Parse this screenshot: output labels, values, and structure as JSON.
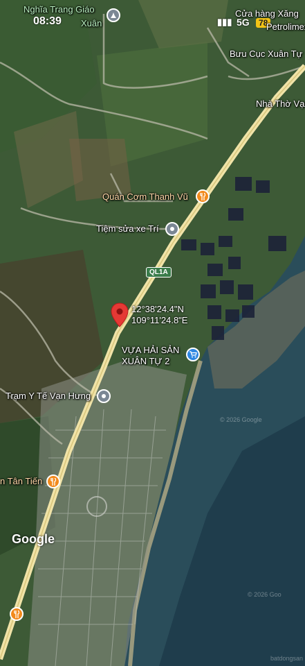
{
  "status_bar": {
    "time": "08:39",
    "signal": "5G",
    "badge": "78"
  },
  "places": {
    "cemetery": "Nghĩa Trang Giáo",
    "cemetery_sub": "Xuân",
    "gas_station": "Cửa hàng Xăng",
    "gas_station_sub": "Petrolimex Số",
    "post_office": "Bưu Cục Xuân Tự",
    "church": "Nhà Thờ Vạn",
    "restaurant": "Quán Cơm Thanh Vũ",
    "motorbike_repair": "Tiệm sửa xe Trí",
    "seafood": "VỰA HẢI SẢN XUÂN TỰ 2",
    "clinic": "Trạm Y Tế Vạn Hưng",
    "restaurant_2": "n Tân Tiến"
  },
  "road_shield": "QL1A",
  "marker": {
    "lat": "12°38'24.4\"N",
    "lng": "109°11'24.8\"E"
  },
  "google_logo": "Google",
  "watermarks": [
    "© 2026 Google",
    "© 2026 Goo",
    "batdongsan"
  ]
}
